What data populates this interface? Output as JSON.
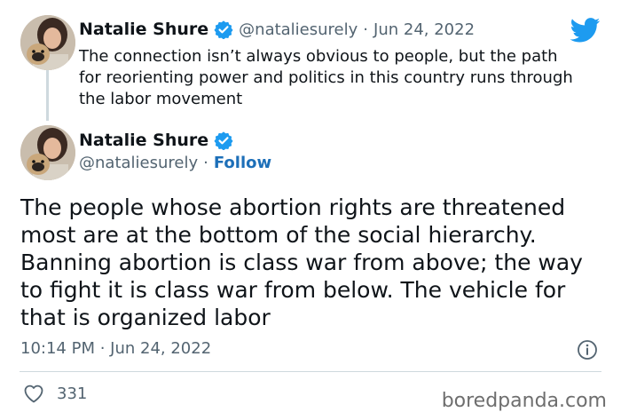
{
  "reply_tweet": {
    "author_name": "Natalie Shure",
    "handle": "@nataliesurely",
    "separator": "·",
    "date": "Jun 24, 2022",
    "text": "The connection isn’t always obvious to people, but the path for reorienting power and politics in this country runs through the labor movement"
  },
  "main_tweet": {
    "author_name": "Natalie Shure",
    "handle": "@nataliesurely",
    "separator": "·",
    "follow_label": "Follow",
    "text": "The people whose abortion rights are threatened most are at the bottom of the social hierarchy. Banning abortion is class war from above; the way to fight it is class war from below. The vehicle for that is organized labor",
    "timestamp": "10:14 PM · Jun 24, 2022"
  },
  "engagement": {
    "likes": "331"
  },
  "watermark": "boredpanda.com",
  "icons": [
    "twitter-bird-icon",
    "verified-badge-icon",
    "info-icon",
    "heart-icon"
  ],
  "colors": {
    "twitter_blue": "#1d9bf0",
    "follow_blue": "#1d6fb8",
    "meta_gray": "#536471",
    "divider": "#cfd9de"
  }
}
